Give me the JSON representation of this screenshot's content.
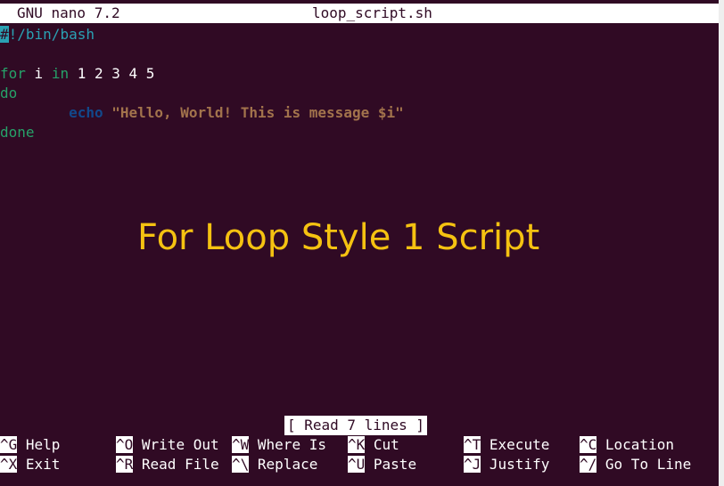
{
  "titlebar": {
    "app_name": "GNU nano 7.2",
    "file_name": "loop_script.sh"
  },
  "editor": {
    "line1": {
      "cursor_char": "#",
      "rest": "!/bin/bash"
    },
    "line3": {
      "kw_for": "for",
      "var": " i ",
      "kw_in": "in",
      "values": " 1 2 3 4 5"
    },
    "line4": {
      "kw_do": "do"
    },
    "line5": {
      "indent": "        ",
      "cmd": "echo",
      "str": " \"Hello, World! This is message $i\""
    },
    "line6": {
      "kw_done": "done"
    }
  },
  "overlay_title": "For Loop Style 1 Script",
  "status_message": "[ Read 7 lines ]",
  "shortcuts": [
    {
      "key": "^G",
      "label": "Help"
    },
    {
      "key": "^O",
      "label": "Write Out"
    },
    {
      "key": "^W",
      "label": "Where Is"
    },
    {
      "key": "^K",
      "label": "Cut"
    },
    {
      "key": "^T",
      "label": "Execute"
    },
    {
      "key": "^C",
      "label": "Location"
    },
    {
      "key": "^X",
      "label": "Exit"
    },
    {
      "key": "^R",
      "label": "Read File"
    },
    {
      "key": "^\\",
      "label": "Replace"
    },
    {
      "key": "^U",
      "label": "Paste"
    },
    {
      "key": "^J",
      "label": "Justify"
    },
    {
      "key": "^/",
      "label": "Go To Line"
    }
  ],
  "colors": {
    "background": "#300a24",
    "accent_cyan": "#2aa1b3",
    "keyword_green": "#26a269",
    "builtin_blue": "#12488b",
    "string_brown": "#a2734c",
    "overlay_yellow": "#f5c211"
  }
}
